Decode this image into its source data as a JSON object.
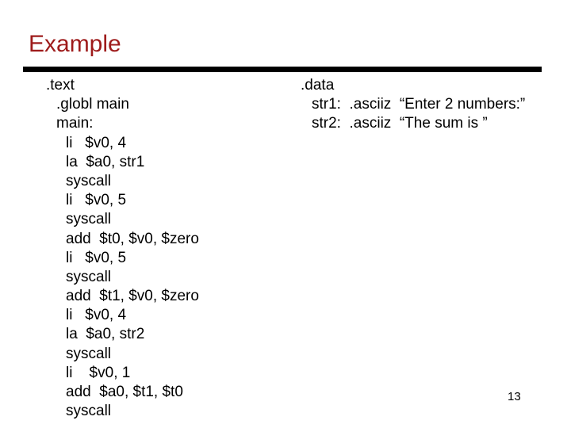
{
  "slide": {
    "title": "Example",
    "page_number": "13",
    "accent_color": "#9E1B1B",
    "text_color": "#000000",
    "background_color": "#FFFFFF",
    "rule_color": "#000000"
  },
  "code": {
    "left_column": {
      "name": "text-segment",
      "lines": [
        {
          "text": ".text",
          "indent": 0
        },
        {
          "text": ".globl main",
          "indent": 1
        },
        {
          "text": "main:",
          "indent": 1
        },
        {
          "text": "li   $v0, 4",
          "indent": 2
        },
        {
          "text": "la  $a0, str1",
          "indent": 2
        },
        {
          "text": "syscall",
          "indent": 2
        },
        {
          "text": "li   $v0, 5",
          "indent": 2
        },
        {
          "text": "syscall",
          "indent": 2
        },
        {
          "text": "add  $t0, $v0, $zero",
          "indent": 2
        },
        {
          "text": "li   $v0, 5",
          "indent": 2
        },
        {
          "text": "syscall",
          "indent": 2
        },
        {
          "text": "add  $t1, $v0, $zero",
          "indent": 2
        },
        {
          "text": "li   $v0, 4",
          "indent": 2
        },
        {
          "text": "la  $a0, str2",
          "indent": 2
        },
        {
          "text": "syscall",
          "indent": 2
        },
        {
          "text": "li    $v0, 1",
          "indent": 2
        },
        {
          "text": "add  $a0, $t1, $t0",
          "indent": 2
        },
        {
          "text": "syscall",
          "indent": 2
        }
      ]
    },
    "right_column": {
      "name": "data-segment",
      "lines": [
        {
          "text": ".data",
          "indent": 0
        },
        {
          "text": "str1:  .asciiz  “Enter 2 numbers:”",
          "indent": 1
        },
        {
          "text": "str2:  .asciiz  “The sum is ”",
          "indent": 1
        }
      ]
    }
  }
}
